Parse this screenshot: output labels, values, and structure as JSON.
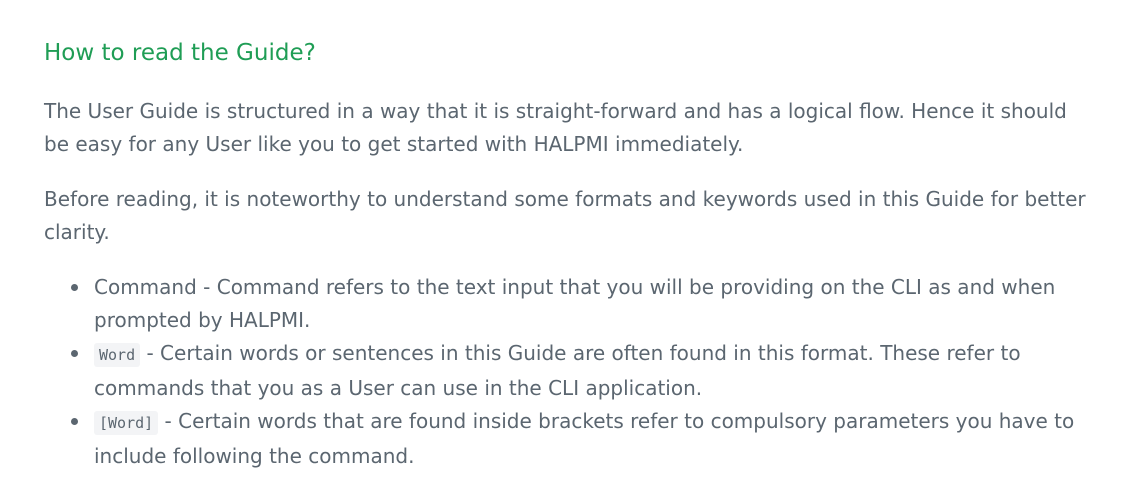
{
  "section": {
    "heading": "How to read the Guide?",
    "paragraphs": [
      "The User Guide is structured in a way that it is straight-forward and has a logical flow. Hence it should be easy for any User like you to get started with HALPMI immediately.",
      "Before reading, it is noteworthy to understand some formats and keywords used in this Guide for better clarity."
    ],
    "list": [
      {
        "term": "",
        "text": "Command - Command refers to the text input that you will be providing on the CLI as and when prompted by HALPMI."
      },
      {
        "term": "Word",
        "text": " - Certain words or sentences in this Guide are often found in this format. These refer to commands that you as a User can use in the CLI application."
      },
      {
        "term": "[Word]",
        "text": " - Certain words that are found inside brackets refer to compulsory parameters you have to include following the command."
      }
    ]
  },
  "colors": {
    "heading": "#1f9d55",
    "body_text": "#5b6670",
    "code_bg": "#f3f4f6"
  }
}
